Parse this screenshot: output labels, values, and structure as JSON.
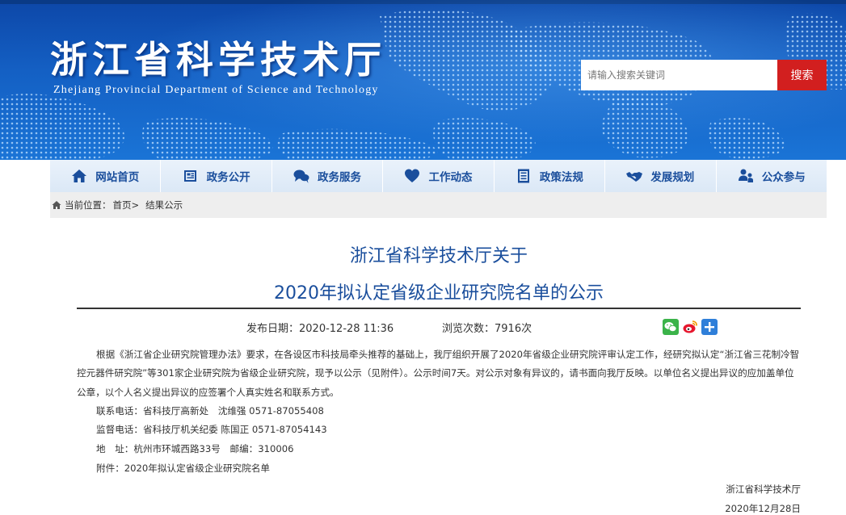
{
  "header": {
    "title": "浙江省科学技术厅",
    "subtitle": "Zhejiang Provincial Department of Science and Technology",
    "search_placeholder": "请输入搜索关键词",
    "search_button": "搜索",
    "colors": {
      "banner": "#1460c4",
      "search_button": "#d21f1f"
    }
  },
  "nav": {
    "items": [
      {
        "label": "网站首页",
        "icon": "home-icon"
      },
      {
        "label": "政务公开",
        "icon": "document-icon"
      },
      {
        "label": "政务服务",
        "icon": "chat-icon"
      },
      {
        "label": "工作动态",
        "icon": "heart-icon"
      },
      {
        "label": "政策法规",
        "icon": "list-icon"
      },
      {
        "label": "发展规划",
        "icon": "handshake-icon"
      },
      {
        "label": "公众参与",
        "icon": "people-icon"
      }
    ],
    "color": "#1a4e9c"
  },
  "breadcrumb": {
    "prefix": "当前位置：",
    "home": "首页>",
    "current": "结果公示"
  },
  "article": {
    "title_line1": "浙江省科学技术厅关于",
    "title_line2": "2020年拟认定省级企业研究院名单的公示",
    "publish_date": "发布日期：2020-12-28 11:36",
    "views": "浏览次数：7916次",
    "share_icons": [
      "wechat-icon",
      "weibo-icon",
      "plus-icon"
    ],
    "paragraph": "根据《浙江省企业研究院管理办法》要求，在各设区市科技局牵头推荐的基础上，我厅组织开展了2020年省级企业研究院评审认定工作，经研究拟认定“浙江省三花制冷智控元器件研究院”等301家企业研究院为省级企业研究院，现予以公示（见附件）。公示时间7天。对公示对象有异议的，请书面向我厅反映。以单位名义提出异议的应加盖单位公章，以个人名义提出异议的应签署个人真实姓名和联系方式。",
    "contact": "联系电话：省科技厅高新处　沈维强 0571-87055408",
    "supervise": "监督电话：省科技厅机关纪委  陈国正 0571-87054143",
    "address": "地　址：杭州市环城西路33号　邮编：310006",
    "attachment": "附件：2020年拟认定省级企业研究院名单",
    "signature_org": "浙江省科学技术厅",
    "signature_date": "2020年12月28日"
  }
}
